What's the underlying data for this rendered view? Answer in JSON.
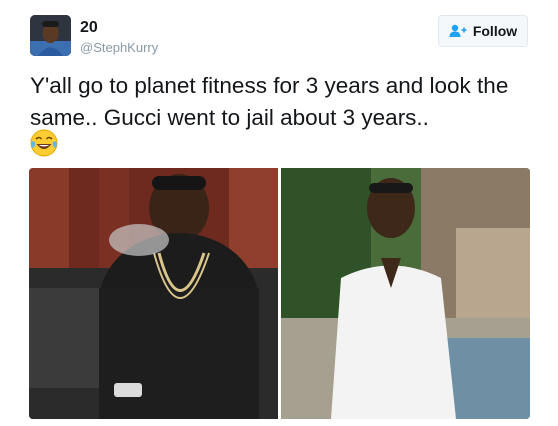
{
  "author": {
    "display_name": "20",
    "handle": "@StephKurry",
    "avatar_icon": "profile-avatar"
  },
  "follow_button": {
    "label": "Follow",
    "icon": "add-user-icon"
  },
  "tweet": {
    "text": "Y'all go to planet fitness for 3 years and look the same.. Gucci went to jail about 3 years..",
    "emoji": "face-with-tears-of-joy"
  },
  "media": [
    {
      "name": "photo-before",
      "description_icon": "photo"
    },
    {
      "name": "photo-after",
      "description_icon": "photo"
    }
  ],
  "colors": {
    "text": "#14171a",
    "handle": "#8899a6",
    "button_bg": "#f5f8fa",
    "button_border": "#e1e8ed",
    "accent": "#1da1f2"
  }
}
